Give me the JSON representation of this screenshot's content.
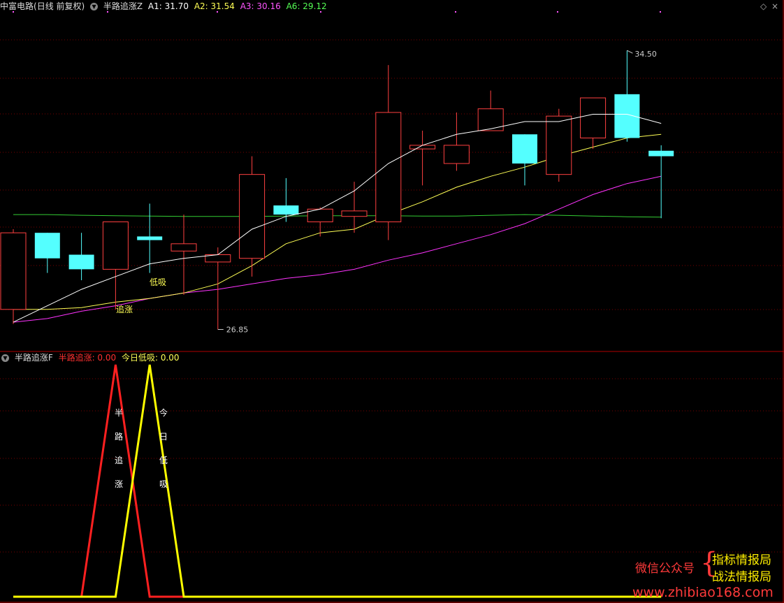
{
  "main_header": {
    "stock": "中富电路",
    "mode": "(日线 前复权)",
    "indicator": "半路追涨Z",
    "a1": "A1: 31.70",
    "a2": "A2: 31.54",
    "a3": "A3: 30.16",
    "a6": "A6: 29.12"
  },
  "sub_header": {
    "indicator": "半路追涨F",
    "v1": "半路追涨: 0.00",
    "v2": "今日低吸: 0.00"
  },
  "window_controls": {
    "diamond": "◇",
    "close": "×"
  },
  "labels": {
    "high": "34.50",
    "low": "26.85",
    "dixi": "低吸",
    "zhuizhang": "追涨",
    "v1": [
      "半",
      "路",
      "追",
      "涨"
    ],
    "v2": [
      "今",
      "日",
      "低",
      "吸"
    ]
  },
  "watermark": {
    "l1": "微信公众号",
    "r1": "指标情报局",
    "r2": "战法情报局",
    "url": "www.zhibiao168.com"
  },
  "colors": {
    "up": "#ff4040",
    "down": "#54ffff",
    "ma_white": "#ffffff",
    "ma_yellow": "#ffff55",
    "ma_magenta": "#ff33ff",
    "ma_green": "#33cc33",
    "grid": "#7a0000",
    "border": "#b00000",
    "header_magenta": "#ff55ff",
    "header_yellow": "#ffff55",
    "header_green": "#55ff55",
    "sig_red": "#ff2020",
    "sig_yellow": "#ffff00",
    "wm_red": "#ff3a3a",
    "wm_yellow": "#ffee00"
  },
  "chart_data": {
    "type": "candlestick",
    "candles": [
      {
        "o": 27.4,
        "h": 29.6,
        "l": 27.0,
        "c": 29.5
      },
      {
        "o": 29.5,
        "h": 29.5,
        "l": 28.4,
        "c": 28.8
      },
      {
        "o": 28.9,
        "h": 29.5,
        "l": 28.2,
        "c": 28.5
      },
      {
        "o": 28.5,
        "h": 29.8,
        "l": 27.4,
        "c": 29.8
      },
      {
        "o": 29.4,
        "h": 30.3,
        "l": 28.4,
        "c": 29.3
      },
      {
        "o": 29.0,
        "h": 30.0,
        "l": 27.8,
        "c": 29.2
      },
      {
        "o": 28.7,
        "h": 29.1,
        "l": 26.85,
        "c": 28.9
      },
      {
        "o": 28.8,
        "h": 31.6,
        "l": 28.3,
        "c": 31.1
      },
      {
        "o": 30.25,
        "h": 31.0,
        "l": 29.8,
        "c": 30.0
      },
      {
        "o": 29.8,
        "h": 30.2,
        "l": 29.4,
        "c": 30.15
      },
      {
        "o": 29.95,
        "h": 30.9,
        "l": 29.5,
        "c": 30.1
      },
      {
        "o": 29.8,
        "h": 34.1,
        "l": 29.3,
        "c": 32.8
      },
      {
        "o": 31.8,
        "h": 32.3,
        "l": 30.8,
        "c": 31.9
      },
      {
        "o": 31.4,
        "h": 32.8,
        "l": 31.2,
        "c": 31.9
      },
      {
        "o": 32.3,
        "h": 33.4,
        "l": 32.3,
        "c": 32.9
      },
      {
        "o": 32.2,
        "h": 32.2,
        "l": 30.8,
        "c": 31.4
      },
      {
        "o": 31.1,
        "h": 32.9,
        "l": 30.9,
        "c": 32.7
      },
      {
        "o": 32.1,
        "h": 33.0,
        "l": 31.8,
        "c": 33.2
      },
      {
        "o": 33.3,
        "h": 34.5,
        "l": 32.0,
        "c": 32.1
      },
      {
        "o": 31.75,
        "h": 31.9,
        "l": 29.9,
        "c": 31.6
      }
    ],
    "ma_white": [
      27.05,
      27.5,
      27.95,
      28.3,
      28.65,
      28.8,
      28.9,
      29.6,
      29.95,
      30.15,
      30.65,
      31.4,
      31.9,
      32.2,
      32.35,
      32.55,
      32.55,
      32.75,
      32.75,
      32.5
    ],
    "ma_yellow": [
      27.4,
      27.4,
      27.45,
      27.6,
      27.7,
      27.85,
      28.1,
      28.6,
      29.2,
      29.5,
      29.6,
      30.0,
      30.35,
      30.75,
      31.05,
      31.3,
      31.6,
      31.85,
      32.1,
      32.2
    ],
    "ma_magenta": [
      27.05,
      27.15,
      27.35,
      27.5,
      27.7,
      27.85,
      27.95,
      28.1,
      28.25,
      28.35,
      28.5,
      28.75,
      28.95,
      29.2,
      29.45,
      29.75,
      30.15,
      30.55,
      30.85,
      31.05
    ],
    "ma_green": [
      30.0,
      30.0,
      29.98,
      29.97,
      29.96,
      29.95,
      29.95,
      29.95,
      29.96,
      29.97,
      29.97,
      29.97,
      29.96,
      29.96,
      29.98,
      30.0,
      29.98,
      29.96,
      29.94,
      29.93
    ],
    "sub_signal_red": [
      0,
      0,
      0,
      1,
      0,
      0,
      0,
      0,
      0,
      0,
      0,
      0,
      0,
      0,
      0,
      0,
      0,
      0,
      0,
      0
    ],
    "sub_signal_yellow": [
      0,
      0,
      0,
      0,
      1,
      0,
      0,
      0,
      0,
      0,
      0,
      0,
      0,
      0,
      0,
      0,
      0,
      0,
      0,
      0
    ],
    "ylim": [
      26.4,
      35.5
    ]
  }
}
